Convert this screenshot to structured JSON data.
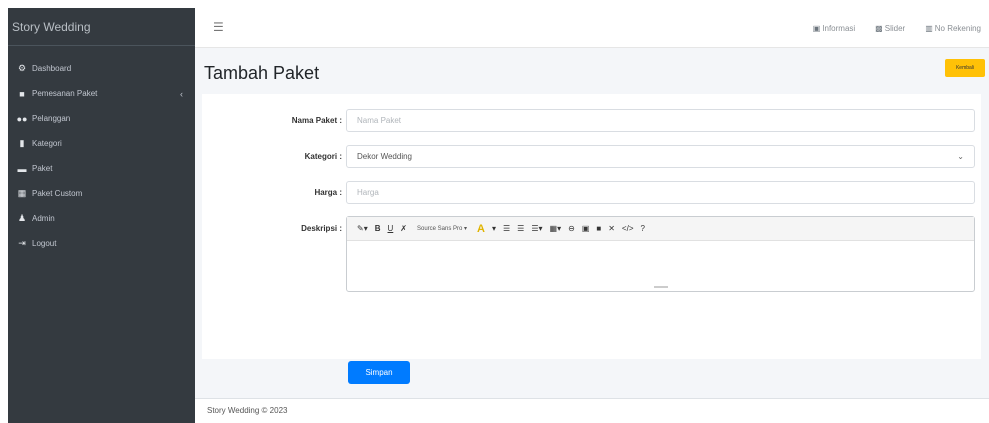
{
  "sidebar": {
    "brand": "Story Wedding",
    "items": [
      {
        "label": "Dashboard",
        "icon": "dashboard-icon",
        "glyph": "⚙"
      },
      {
        "label": "Pemesanan Paket",
        "icon": "cart-icon",
        "glyph": "🛒"
      },
      {
        "label": "Pelanggan",
        "icon": "users-icon",
        "glyph": "👥"
      },
      {
        "label": "Kategori",
        "icon": "file-icon",
        "glyph": "▮"
      },
      {
        "label": "Paket",
        "icon": "inbox-icon",
        "glyph": "▬"
      },
      {
        "label": "Paket Custom",
        "icon": "table-icon",
        "glyph": "▦"
      },
      {
        "label": "Admin",
        "icon": "user-icon",
        "glyph": "♟"
      },
      {
        "label": "Logout",
        "icon": "logout-icon",
        "glyph": "⇥"
      }
    ]
  },
  "topbar": {
    "links": [
      {
        "label": "Informasi",
        "icon": "info-icon",
        "glyph": "▣"
      },
      {
        "label": "Slider",
        "icon": "image-icon",
        "glyph": "▩"
      },
      {
        "label": "No Rekening",
        "icon": "bank-icon",
        "glyph": "▥"
      }
    ]
  },
  "page": {
    "title": "Tambah Paket",
    "back_label": "Kembali"
  },
  "form": {
    "nama_label": "Nama Paket :",
    "nama_placeholder": "Nama Paket",
    "kategori_label": "Kategori :",
    "kategori_value": "Dekor Wedding",
    "harga_label": "Harga :",
    "harga_placeholder": "Harga",
    "deskripsi_label": "Deskripsi :",
    "font_name": "Source Sans Pro",
    "save_label": "Simpan"
  },
  "footer": {
    "text": "Story Wedding © 2023"
  },
  "colors": {
    "sidebar": "#343a40",
    "primary": "#007bff",
    "warning": "#ffc107",
    "content_bg": "#f4f6f9"
  }
}
